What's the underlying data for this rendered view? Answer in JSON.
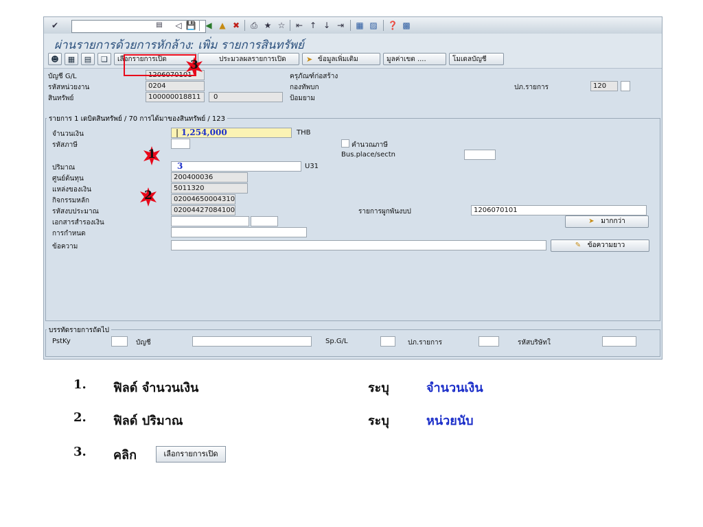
{
  "app": {
    "title": "ผ่านรายการด้วยการหักล้าง: เพิ่ม รายการสินทรัพย์"
  },
  "command_field": {
    "value": "",
    "placeholder": ""
  },
  "application_toolbar": {
    "select_open_items": "เลือกรายการเปิด",
    "process_open_items": "ประมวลผลรายการเปิด",
    "additional_data": "ข้อมูลเพิ่มเติม",
    "currency_value": "มูลค่าเขต ....",
    "account_model": "โมเดลบัญชี"
  },
  "header": {
    "gl_account_label": "บัญชี G/L",
    "gl_account_value": "1206070101",
    "gl_account_text": "ครุภัณฑ์ก่อสร้าง",
    "unit_code_label": "รหัสหน่วยงาน",
    "unit_code_value": "0204",
    "unit_code_text": "กองทัพบก",
    "asset_label": "สินทรัพย์",
    "asset_value": "100000018811",
    "asset_sub": "0",
    "asset_text": "ป้อมยาม",
    "item_type_label": "ปภ.รายการ",
    "item_type_value": "120"
  },
  "item": {
    "group_title": "รายการ 1 เดบิตสินทรัพย์ / 70 การได้มาของสินทรัพย์ / 123",
    "amount_label": "จำนวนเงิน",
    "amount_value": "1,254,000",
    "currency": "THB",
    "tax_code_label": "รหัสภาษี",
    "calc_tax_label": "คำนวณภาษี",
    "bus_place_label": "Bus.place/sectn",
    "quantity_label": "ปริมาณ",
    "quantity_value": "3",
    "unit": "U31",
    "cost_center_label": "ศูนย์ต้นทุน",
    "cost_center_value": "200400036",
    "fund_label": "แหล่งของเงิน",
    "fund_value": "5011320",
    "main_activity_label": "กิจกรรมหลัก",
    "main_activity_value": "02004650004310",
    "budget_code_label": "รหัสงบประมาณ",
    "budget_code_value": "0200442708410002",
    "earmark_doc_label": "เอกสารสำรองเงิน",
    "assignment_label": "การกำหนด",
    "text_label": "ข้อความ",
    "binding_label": "รายการผูกพันงบป",
    "binding_value": "1206070101",
    "more_button": "มากกว่า",
    "long_text_button": "ข้อความยาว"
  },
  "next_line": {
    "group_title": "บรรทัดรายการถัดไป",
    "pstky_label": "PstKy",
    "account_label": "บัญชี",
    "spgl_label": "Sp.G/L",
    "item_type_label": "ปภ.รายการ",
    "company_label": "รหัสบริษัทใ"
  },
  "markers": {
    "m1": "1",
    "m2": "2",
    "m3": "3",
    "color": "#e8081a"
  },
  "instructions": [
    {
      "num": "1.",
      "text": "ฟิลด์ จำนวนเงิน",
      "verb": "ระบุ",
      "value": "จำนวนเงิน"
    },
    {
      "num": "2.",
      "text": "ฟิลด์ ปริมาณ",
      "verb": "ระบุ",
      "value": "หน่วยนับ"
    },
    {
      "num": "3.",
      "text": "คลิก",
      "button": "เลือกรายการเปิด"
    }
  ]
}
